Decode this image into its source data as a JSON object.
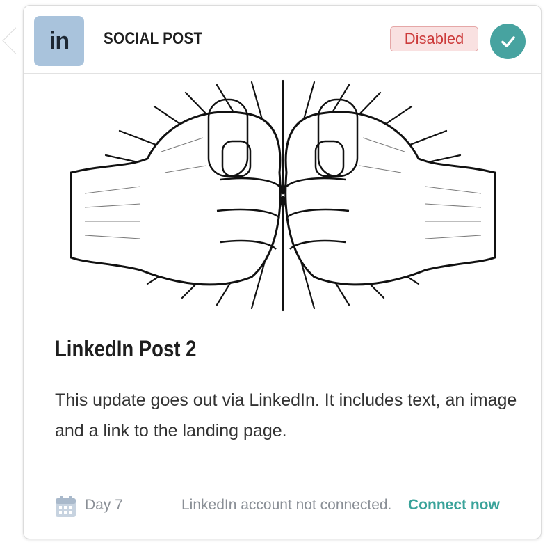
{
  "header": {
    "logo_text": "in",
    "section_label": "SOCIAL POST",
    "status_badge": "Disabled"
  },
  "post": {
    "title": "LinkedIn Post 2",
    "body": "This update goes out via LinkedIn. It includes text, an image and a link to the landing page."
  },
  "footer": {
    "calendar_icon": "calendar-icon",
    "day_label": "Day 7",
    "connection_message": "LinkedIn account not connected.",
    "connect_link": "Connect now"
  },
  "colors": {
    "logo_tile": "#a9c3dc",
    "badge_bg": "#f9e1e1",
    "badge_text": "#cc3b3b",
    "check_button": "#47a3a0",
    "link": "#3aa39a"
  }
}
